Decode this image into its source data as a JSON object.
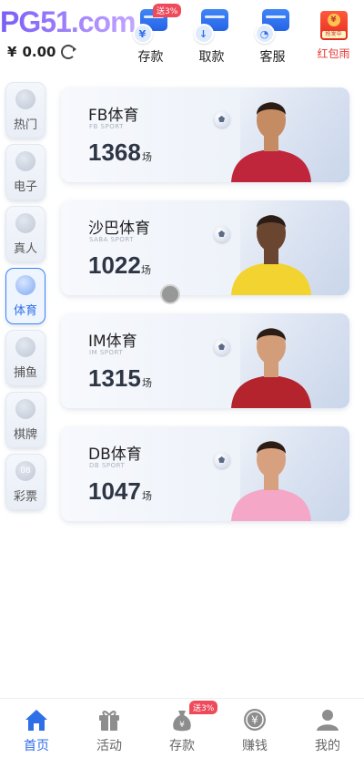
{
  "header": {
    "logo": "PG51.com",
    "currency_symbol": "¥",
    "balance": "0.00",
    "refresh_icon": "refresh-icon"
  },
  "top_actions": [
    {
      "label": "存款",
      "icon": "deposit-icon",
      "badge": "送3%"
    },
    {
      "label": "取款",
      "icon": "withdraw-icon"
    },
    {
      "label": "客服",
      "icon": "customer-service-icon"
    },
    {
      "label": "红包雨",
      "icon": "red-envelope-icon",
      "icon_text": "抢发中"
    }
  ],
  "sidebar": {
    "items": [
      {
        "label": "热门",
        "icon": "fire-icon",
        "active": false
      },
      {
        "label": "电子",
        "icon": "gamepad-icon",
        "active": false
      },
      {
        "label": "真人",
        "icon": "live-icon",
        "active": false
      },
      {
        "label": "体育",
        "icon": "sport-ball-icon",
        "active": true
      },
      {
        "label": "捕鱼",
        "icon": "fish-icon",
        "active": false
      },
      {
        "label": "棋牌",
        "icon": "cards-icon",
        "active": false
      },
      {
        "label": "彩票",
        "icon": "lottery-icon",
        "icon_text": "08",
        "active": false
      }
    ]
  },
  "games": [
    {
      "name": "FB体育",
      "sub": "FB SPORT",
      "count": "1368",
      "unit": "场",
      "jersey": "#c0263b",
      "skin": "#c58b63"
    },
    {
      "name": "沙巴体育",
      "sub": "SABA SPORT",
      "count": "1022",
      "unit": "场",
      "jersey": "#f3d330",
      "skin": "#6a4530"
    },
    {
      "name": "IM体育",
      "sub": "IM SPORT",
      "count": "1315",
      "unit": "场",
      "jersey": "#b3242c",
      "skin": "#d39d7a"
    },
    {
      "name": "DB体育",
      "sub": "DB SPORT",
      "count": "1047",
      "unit": "场",
      "jersey": "#f5a7c8",
      "skin": "#d7a07e"
    }
  ],
  "bottom_nav": [
    {
      "label": "首页",
      "icon": "home-icon",
      "active": true
    },
    {
      "label": "活动",
      "icon": "gift-icon",
      "active": false
    },
    {
      "label": "存款",
      "icon": "money-bag-icon",
      "active": false,
      "badge": "送3%"
    },
    {
      "label": "赚钱",
      "icon": "coin-icon",
      "active": false
    },
    {
      "label": "我的",
      "icon": "user-icon",
      "active": false
    }
  ]
}
